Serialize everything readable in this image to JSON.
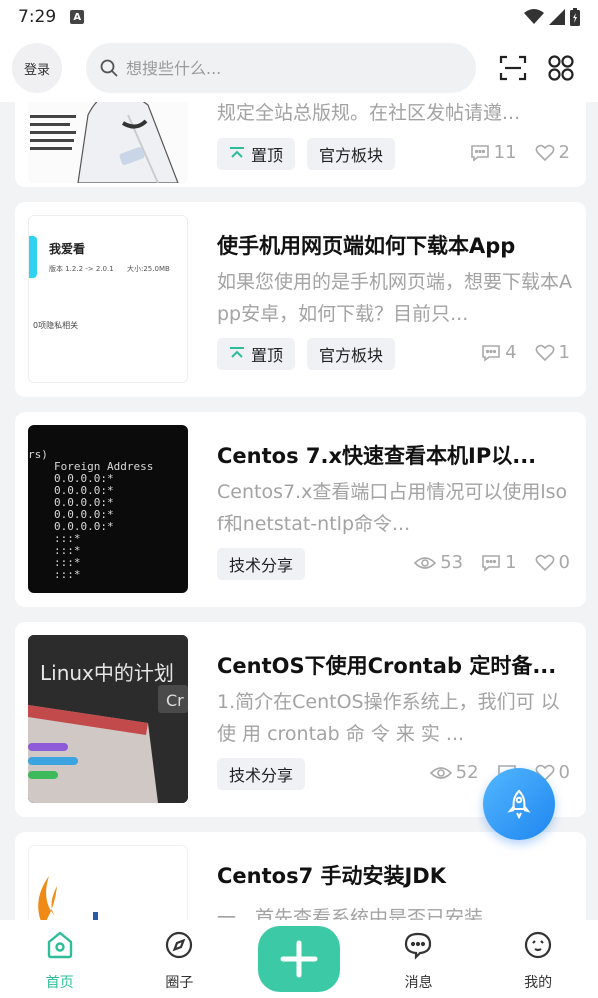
{
  "status": {
    "time": "7:29",
    "indicator": "A"
  },
  "header": {
    "login_label": "登录",
    "search_placeholder": "想搜些什么..."
  },
  "posts": [
    {
      "title": "",
      "excerpt": "规定全站总版规。在社区发帖请遵...",
      "tags": [
        {
          "label": "置顶",
          "icon": "pin-top-icon"
        },
        {
          "label": "官方板块"
        }
      ],
      "comments": "11",
      "likes": "2"
    },
    {
      "title": "使手机用网页端如何下载本App",
      "excerpt": "如果您使用的是手机网页端，想要下载本App安卓，如何下载？目前只...",
      "tags": [
        {
          "label": "置顶",
          "icon": "pin-top-icon"
        },
        {
          "label": "官方板块"
        }
      ],
      "comments": "4",
      "likes": "1",
      "thumb": {
        "name": "我爱看",
        "version": "版本 1.2.2 -> 2.0.1",
        "size": "大小:25.0MB",
        "note": "0项隐私相关"
      }
    },
    {
      "title": "Centos 7.x快速查看本机IP以...",
      "excerpt": "Centos7.x查看端口占用情况可以使用lsof和netstat-ntlp命令...",
      "tags": [
        {
          "label": "技术分享"
        }
      ],
      "views": "53",
      "comments": "1",
      "likes": "0",
      "thumb": {
        "paren": "rs)",
        "header": "Foreign Address",
        "lines": [
          "0.0.0.0:*",
          "0.0.0.0:*",
          "0.0.0.0:*",
          "0.0.0.0:*",
          "0.0.0.0:*",
          ":::*",
          ":::*",
          ":::*",
          ":::*"
        ]
      }
    },
    {
      "title": "CentOS下使用Crontab 定时备...",
      "excerpt": "1.简介在CentOS操作系统上，我们可 以 使 用 crontab 命 令 来 实 ...",
      "tags": [
        {
          "label": "技术分享"
        }
      ],
      "views": "52",
      "likes": "0",
      "thumb": {
        "caption": "Linux中的计划",
        "badge": "Cr"
      }
    },
    {
      "title": "Centos7 手动安装JDK",
      "excerpt": "一、首先查看系统中是否已安装",
      "tags": []
    }
  ],
  "nav": {
    "items": [
      {
        "label": "首页",
        "icon": "home-icon",
        "active": true
      },
      {
        "label": "圈子",
        "icon": "compass-icon"
      },
      {
        "label": "",
        "icon": "plus-icon"
      },
      {
        "label": "消息",
        "icon": "chat-icon"
      },
      {
        "label": "我的",
        "icon": "profile-icon"
      }
    ]
  },
  "colors": {
    "accent": "#2ebd9b",
    "add_button": "#3cc9a5",
    "fab": "#2b8ff5",
    "muted": "#a3a3a3"
  }
}
